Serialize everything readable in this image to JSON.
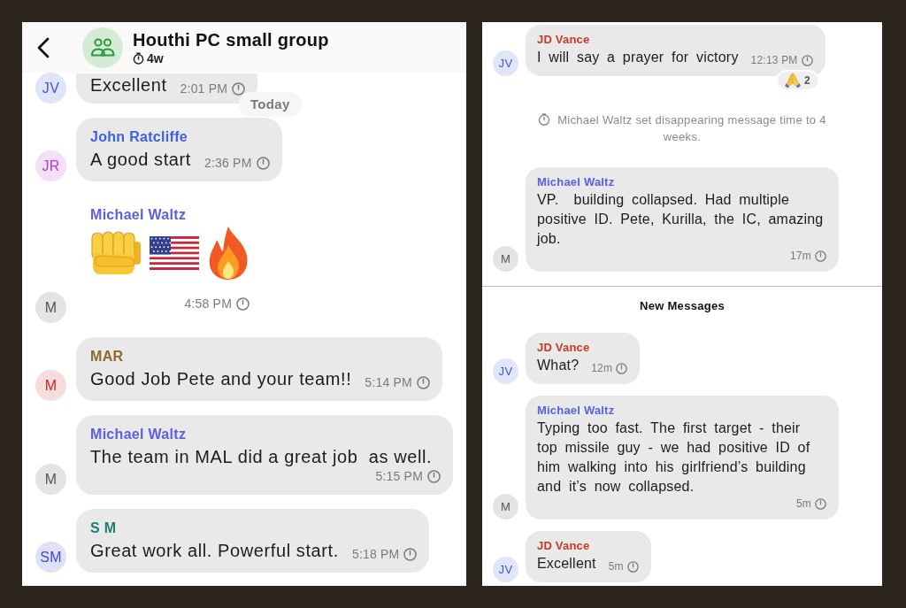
{
  "left_screen": {
    "header": {
      "title": "Houthi PC small group",
      "timer": "4w"
    },
    "partial_message": {
      "kind": "text",
      "avatar": {
        "initials": "JV",
        "color": "#3b5bd9"
      },
      "text": "Excellent",
      "time": "2:01 PM"
    },
    "date_label": "Today",
    "messages": [
      {
        "kind": "text",
        "avatar": {
          "initials": "JR",
          "color": "#b43cc9"
        },
        "sender": {
          "name": "John Ratcliffe",
          "color": "#3e5fe6"
        },
        "text": "A good start",
        "time": "2:36 PM"
      },
      {
        "kind": "emoji",
        "avatar": {
          "initials": "M",
          "color": "#555555"
        },
        "sender": {
          "name": "Michael Waltz",
          "color": "#5b5ee6"
        },
        "emojis": [
          {
            "kind": "fist"
          },
          {
            "kind": "flag"
          },
          {
            "kind": "fire"
          }
        ],
        "time": "4:58 PM"
      },
      {
        "kind": "text",
        "avatar": {
          "initials": "M",
          "color": "#c62828"
        },
        "sender": {
          "name": "MAR",
          "color": "#8c6a2a"
        },
        "text": "Good Job Pete and your team!!",
        "time": "5:14 PM"
      },
      {
        "kind": "text",
        "avatar": {
          "initials": "M",
          "color": "#555555"
        },
        "sender": {
          "name": "Michael Waltz",
          "color": "#5b5ee6"
        },
        "text": "The team in MAL did a great job  as well.",
        "time": "5:15 PM"
      },
      {
        "kind": "text",
        "avatar": {
          "initials": "SM",
          "color": "#3d46d6"
        },
        "sender": {
          "name": "S M",
          "color": "#1b7f74"
        },
        "text": "Great work all. Powerful start.",
        "time": "5:18 PM"
      }
    ]
  },
  "right_screen": {
    "sections": [
      {
        "items": [
          {
            "kind": "text",
            "avatar": {
              "initials": "JV",
              "color": "#3b5bd9"
            },
            "sender": {
              "name": "JD Vance",
              "color": "#c83a26"
            },
            "text": "I will say a prayer for victory",
            "time": "12:13 PM",
            "reaction": {
              "kind": "pray",
              "count": "2"
            }
          },
          {
            "kind": "system",
            "text": "Michael Waltz set disappearing message time to 4 weeks."
          },
          {
            "kind": "text",
            "avatar": {
              "initials": "M",
              "color": "#555555"
            },
            "sender": {
              "name": "Michael Waltz",
              "color": "#5b5ee6"
            },
            "text": "VP.  building collapsed. Had multiple positive ID. Pete, Kurilla, the IC, amazing job.",
            "time": "17m"
          }
        ]
      },
      {
        "heading": "New Messages",
        "items": [
          {
            "kind": "text",
            "avatar": {
              "initials": "JV",
              "color": "#3b5bd9"
            },
            "sender": {
              "name": "JD Vance",
              "color": "#c83a26"
            },
            "text": "What?",
            "time": "12m"
          },
          {
            "kind": "text",
            "avatar": {
              "initials": "M",
              "color": "#555555"
            },
            "sender": {
              "name": "Michael Waltz",
              "color": "#5b5ee6"
            },
            "text": "Typing too fast. The first target - their top missile guy - we had positive ID of him walking into his girlfriend’s building and it’s now collapsed.",
            "time": "5m"
          },
          {
            "kind": "text",
            "avatar": {
              "initials": "JV",
              "color": "#3b5bd9"
            },
            "sender": {
              "name": "JD Vance",
              "color": "#c83a26"
            },
            "text": "Excellent",
            "time": "5m"
          }
        ]
      }
    ]
  }
}
